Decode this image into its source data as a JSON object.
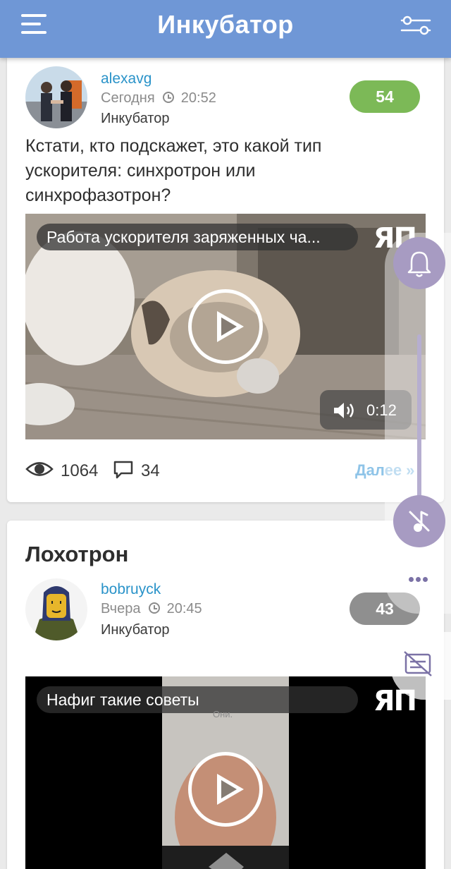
{
  "header": {
    "title": "Инкубатор"
  },
  "posts": [
    {
      "author": "alexavg",
      "date": "Сегодня",
      "time": "20:52",
      "community": "Инкубатор",
      "rating": "54",
      "rating_color": "#7cb957",
      "text": "Кстати, кто подскажет, это какой тип ускорителя: синхротрон или синхрофазотрон?",
      "video": {
        "title": "Работа ускорителя заряженных ча...",
        "logo": "ЯП",
        "duration": "0:12"
      },
      "views": "1064",
      "comments": "34",
      "more": "Далее »"
    },
    {
      "title": "Лохотрон",
      "author": "bobruyck",
      "date": "Вчера",
      "time": "20:45",
      "community": "Инкубатор",
      "rating": "43",
      "rating_color": "#8f8f8f",
      "video": {
        "title": "Нафиг такие советы",
        "logo": "ЯП",
        "watermark": "Они."
      }
    }
  ],
  "colors": {
    "header_bg": "#6f97d6",
    "link": "#2a93c9",
    "fab": "#a79bc2"
  },
  "side_panel": {
    "icons": [
      "bell-icon",
      "music-off-icon",
      "more-dots-icon",
      "subtitles-off-icon"
    ]
  }
}
